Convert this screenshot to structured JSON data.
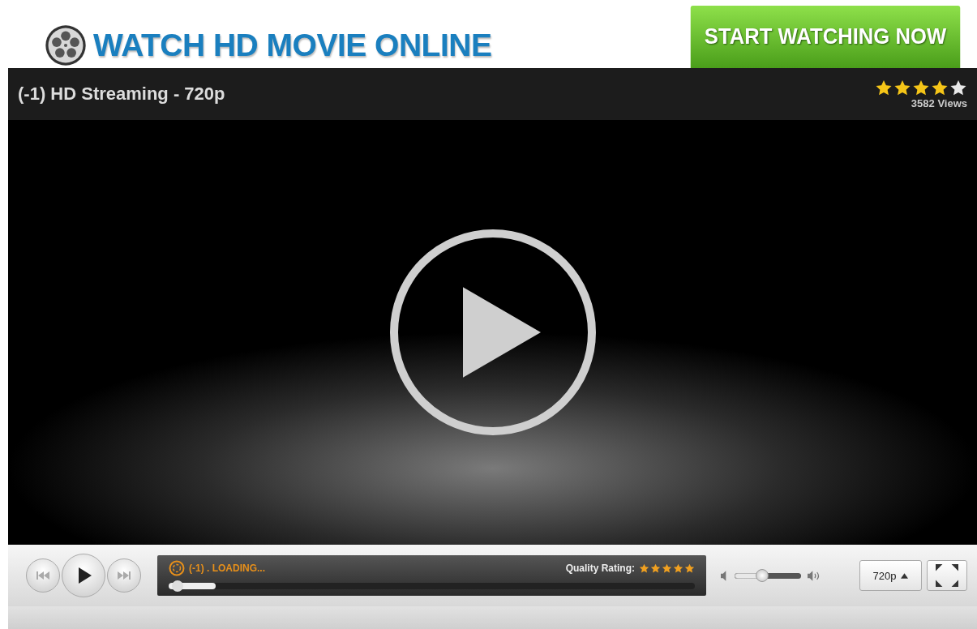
{
  "header": {
    "logo_text": "WATCH HD MOVIE ONLINE",
    "cta_button": "START WATCHING NOW"
  },
  "player": {
    "title": "(-1) HD Streaming - 720p",
    "stars": 4,
    "views": "3582 Views",
    "status_text": "(-1) . LOADING...",
    "progress": {
      "level": 0.01
    },
    "buffered": {
      "level": 0.09
    },
    "quality_rating": {
      "label": "Quality Rating:",
      "stars": 5
    },
    "volume": {
      "level": 0.42
    },
    "quality_button": "720p"
  }
}
